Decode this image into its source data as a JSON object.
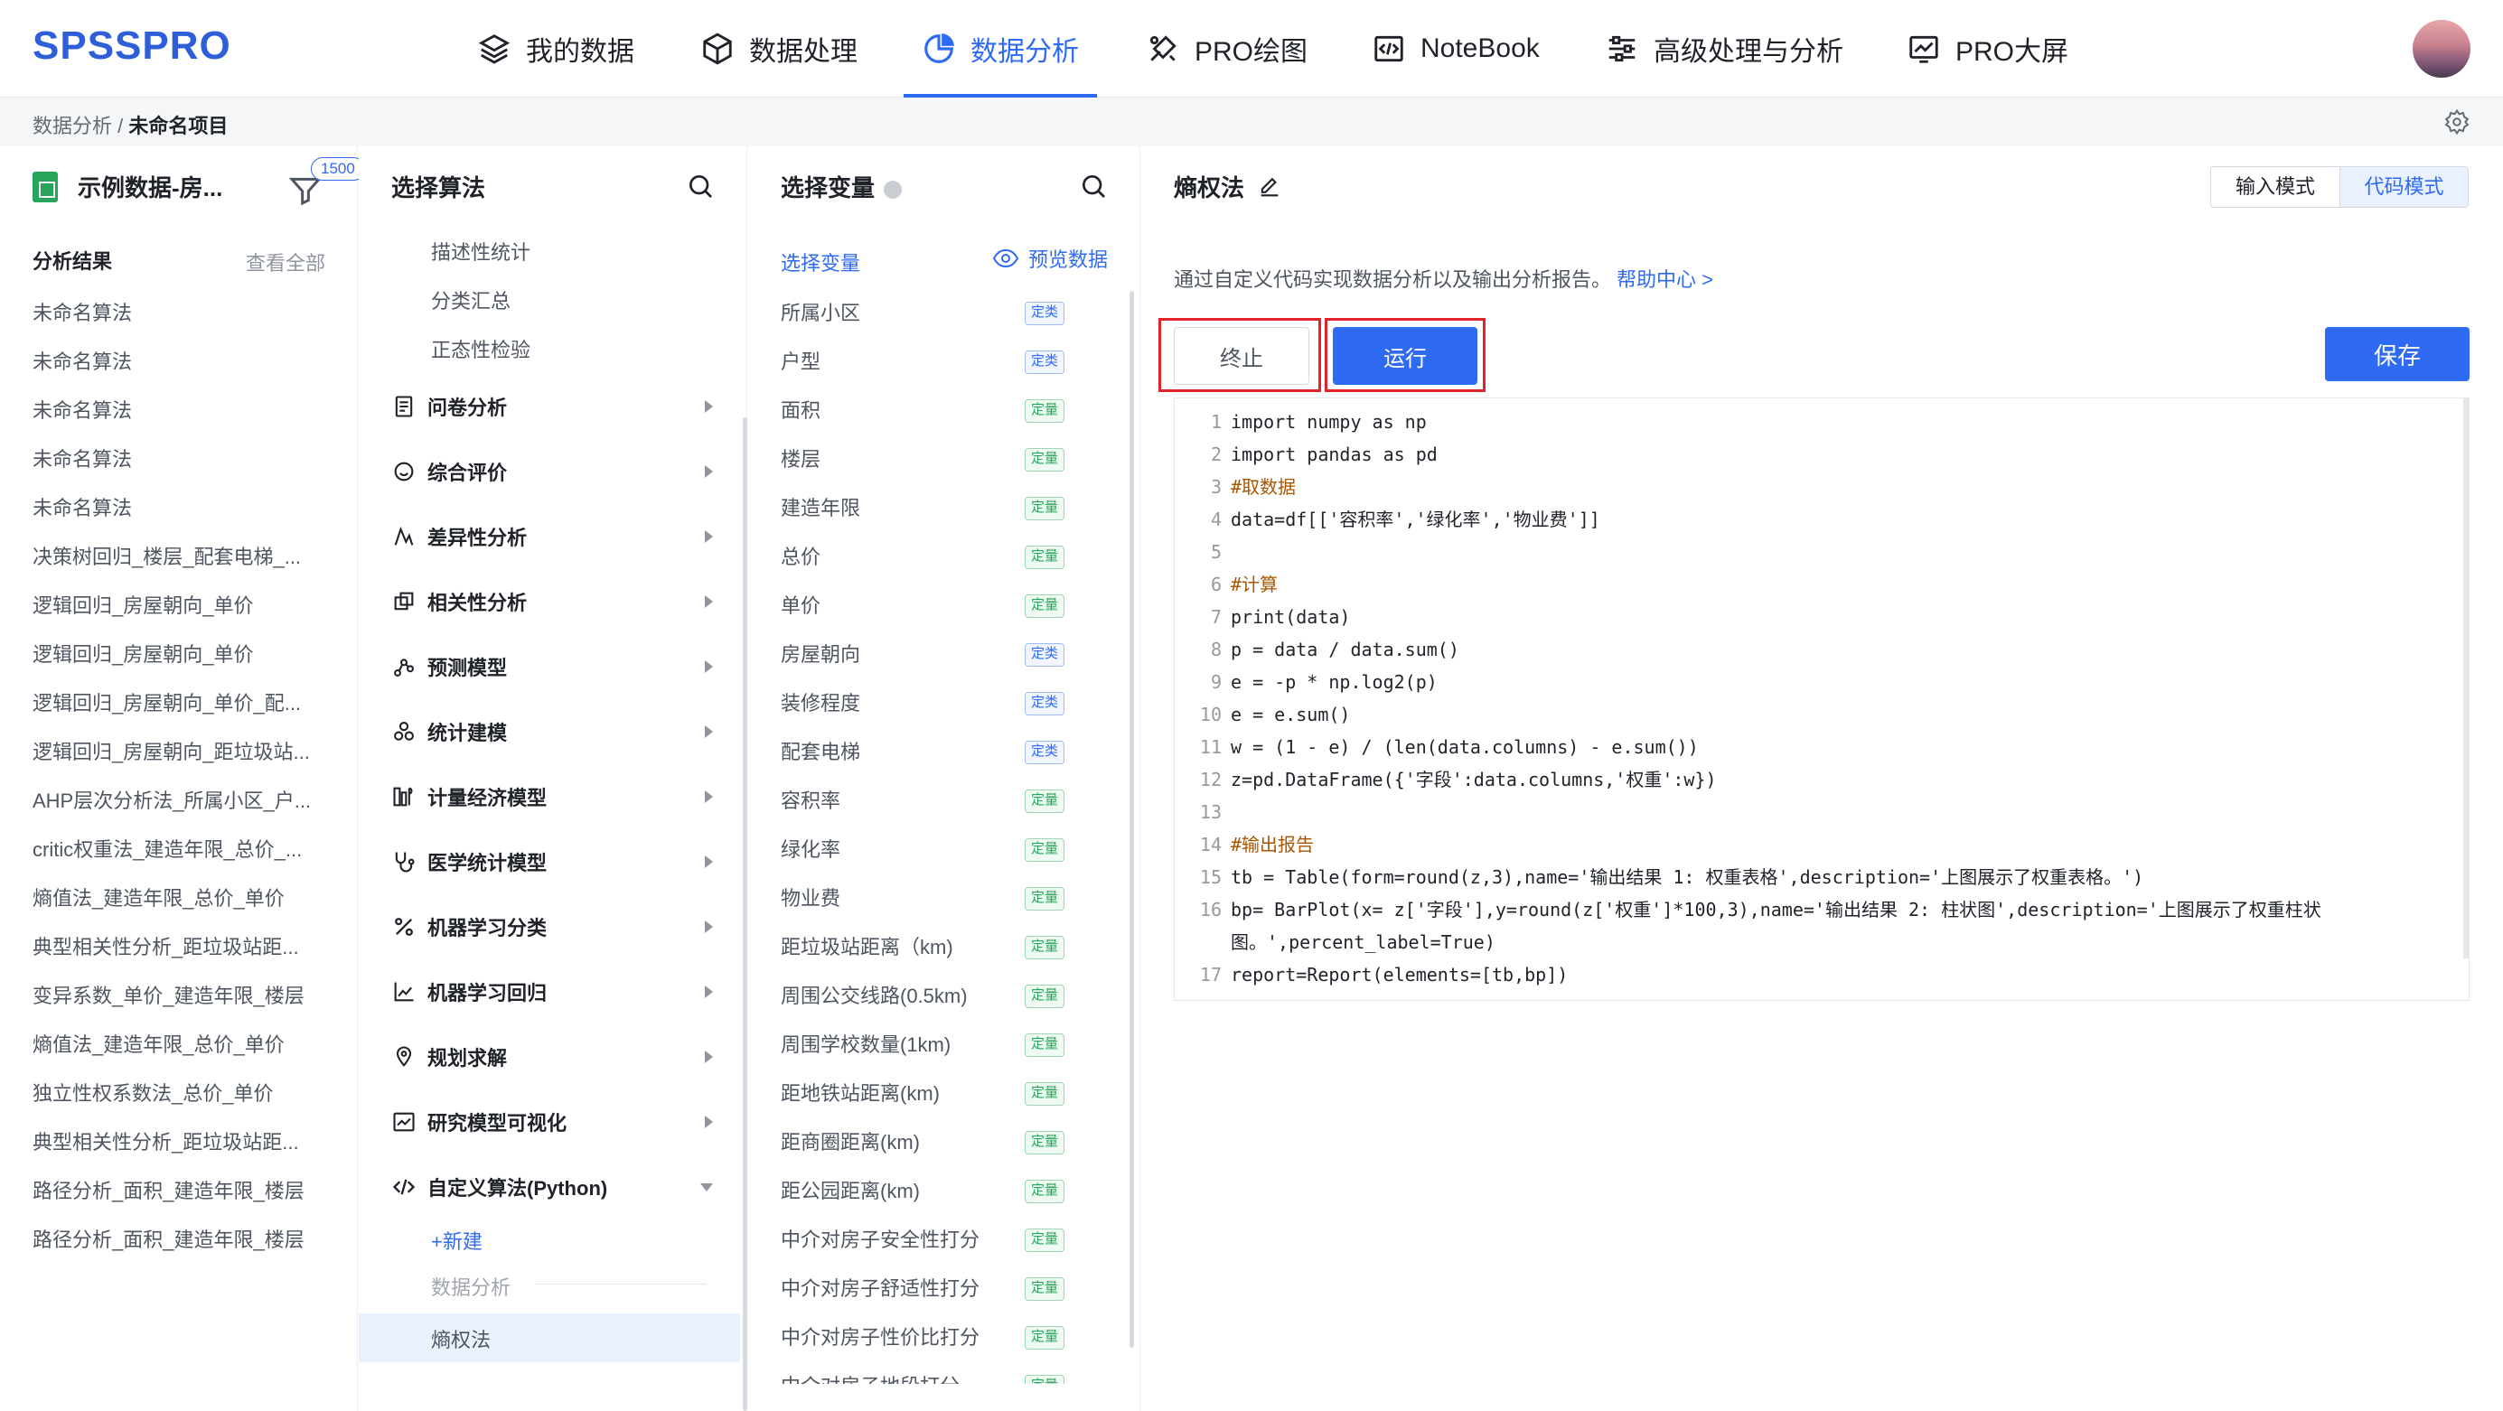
{
  "brand": "SPSSPRO",
  "nav": [
    {
      "label": "我的数据",
      "icon": "layers-icon"
    },
    {
      "label": "数据处理",
      "icon": "cube-icon"
    },
    {
      "label": "数据分析",
      "icon": "pie-chart-icon",
      "active": true
    },
    {
      "label": "PRO绘图",
      "icon": "paint-tools-icon"
    },
    {
      "label": "NoteBook",
      "icon": "code-window-icon"
    },
    {
      "label": "高级处理与分析",
      "icon": "sliders-icon"
    },
    {
      "label": "PRO大屏",
      "icon": "monitor-chart-icon"
    }
  ],
  "breadcrumb": {
    "parent": "数据分析",
    "separator": "/",
    "current": "未命名项目"
  },
  "dataset": {
    "name": "示例数据-房...",
    "badge": "1500"
  },
  "results": {
    "title": "分析结果",
    "view_all": "查看全部",
    "items": [
      "未命名算法",
      "未命名算法",
      "未命名算法",
      "未命名算法",
      "未命名算法",
      "决策树回归_楼层_配套电梯_...",
      "逻辑回归_房屋朝向_单价",
      "逻辑回归_房屋朝向_单价",
      "逻辑回归_房屋朝向_单价_配...",
      "逻辑回归_房屋朝向_距垃圾站...",
      "AHP层次分析法_所属小区_户...",
      "critic权重法_建造年限_总价_...",
      "熵值法_建造年限_总价_单价",
      "典型相关性分析_距垃圾站距...",
      "变异系数_单价_建造年限_楼层",
      "熵值法_建造年限_总价_单价",
      "独立性权系数法_总价_单价",
      "典型相关性分析_距垃圾站距...",
      "路径分析_面积_建造年限_楼层",
      "路径分析_面积_建造年限_楼层"
    ]
  },
  "algorithms": {
    "title": "选择算法",
    "sub_items": [
      "描述性统计",
      "分类汇总",
      "正态性检验"
    ],
    "categories": [
      {
        "label": "问卷分析",
        "icon": "survey-icon"
      },
      {
        "label": "综合评价",
        "icon": "chat-bubble-icon"
      },
      {
        "label": "差异性分析",
        "icon": "difference-icon"
      },
      {
        "label": "相关性分析",
        "icon": "correlation-icon"
      },
      {
        "label": "预测模型",
        "icon": "prediction-icon"
      },
      {
        "label": "统计建模",
        "icon": "statistics-icon"
      },
      {
        "label": "计量经济模型",
        "icon": "econometrics-icon"
      },
      {
        "label": "医学统计模型",
        "icon": "stethoscope-icon"
      },
      {
        "label": "机器学习分类",
        "icon": "percent-icon"
      },
      {
        "label": "机器学习回归",
        "icon": "regression-icon"
      },
      {
        "label": "规划求解",
        "icon": "planning-icon"
      },
      {
        "label": "研究模型可视化",
        "icon": "visualization-icon"
      },
      {
        "label": "自定义算法(Python)",
        "icon": "code-icon"
      }
    ],
    "new_label": "+新建",
    "group_label": "数据分析",
    "selected": "熵权法"
  },
  "variables": {
    "title": "选择变量",
    "tab": "选择变量",
    "preview": "预览数据",
    "items": [
      {
        "name": "所属小区",
        "type": "定类"
      },
      {
        "name": "户型",
        "type": "定类"
      },
      {
        "name": "面积",
        "type": "定量"
      },
      {
        "name": "楼层",
        "type": "定量"
      },
      {
        "name": "建造年限",
        "type": "定量"
      },
      {
        "name": "总价",
        "type": "定量"
      },
      {
        "name": "单价",
        "type": "定量"
      },
      {
        "name": "房屋朝向",
        "type": "定类"
      },
      {
        "name": "装修程度",
        "type": "定类"
      },
      {
        "name": "配套电梯",
        "type": "定类"
      },
      {
        "name": "容积率",
        "type": "定量"
      },
      {
        "name": "绿化率",
        "type": "定量"
      },
      {
        "name": "物业费",
        "type": "定量"
      },
      {
        "name": "距垃圾站距离（km)",
        "type": "定量"
      },
      {
        "name": "周围公交线路(0.5km)",
        "type": "定量"
      },
      {
        "name": "周围学校数量(1km)",
        "type": "定量"
      },
      {
        "name": "距地铁站距离(km)",
        "type": "定量"
      },
      {
        "name": "距商圈距离(km)",
        "type": "定量"
      },
      {
        "name": "距公园距离(km)",
        "type": "定量"
      },
      {
        "name": "中介对房子安全性打分",
        "type": "定量"
      },
      {
        "name": "中介对房子舒适性打分",
        "type": "定量"
      },
      {
        "name": "中介对房子性价比打分",
        "type": "定量"
      },
      {
        "name": "中介对房子地段打分",
        "type": "定量"
      }
    ]
  },
  "editor_panel": {
    "title": "熵权法",
    "mode_input": "输入模式",
    "mode_code": "代码模式",
    "description": "通过自定义代码实现数据分析以及输出分析报告。",
    "help_link": "帮助中心 >",
    "stop_label": "终止",
    "run_label": "运行",
    "save_label": "保存",
    "highlight_color": "#e0242b",
    "accent_color": "#2f6bf2"
  },
  "code": {
    "line1": "import numpy as np",
    "line2": "import pandas as pd",
    "line3": "#取数据",
    "line4": "data=df[['容积率','绿化率','物业费']]",
    "line5": "",
    "line6": "#计算",
    "line7": "print(data)",
    "line8": "p = data / data.sum()",
    "line9": "e = -p * np.log2(p)",
    "line10": "e = e.sum()",
    "line11": "w = (1 - e) / (len(data.columns) - e.sum())",
    "line12": "z=pd.DataFrame({'字段':data.columns,'权重':w})",
    "line13": "",
    "line14": "#输出报告",
    "line15": "tb = Table(form=round(z,3),name='输出结果 1: 权重表格',description='上图展示了权重表格。')",
    "line16a": "bp= BarPlot(x= z['字段'],y=round(z['权重']*100,3),name='输出结果 2: 柱状图',description='上图展示了权重柱状",
    "line16b": "图。',percent_label=True)",
    "line17": "report=Report(elements=[tb,bp])"
  }
}
